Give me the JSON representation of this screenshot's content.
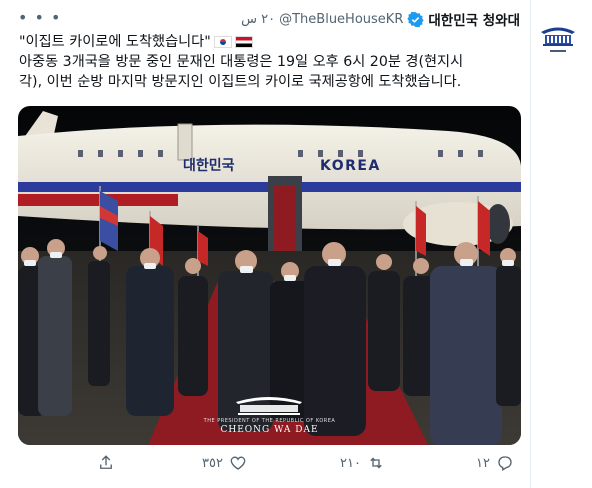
{
  "tweet": {
    "author_name": "대한민국 청와대",
    "handle": "@TheBlueHouseKR",
    "time": "٢٠ س",
    "title_line": "\"이집트 카이로에 도착했습니다\"",
    "body_line1": "아중동 3개국을 방문 중인 문재인 대통령은 19일 오후 6시 20분 경(현지시",
    "body_line2": "각), 이번 순방 마지막 방문지인 이집트의 카이로 국제공항에 도착했습니다."
  },
  "media": {
    "plane_text_korean": "대한민국",
    "plane_text_english": "KOREA",
    "caption_small": "THE PRESIDENT OF THE REPUBLIC OF KOREA",
    "caption_main": "CHEONG WA DAE"
  },
  "actions": {
    "reply_count": "١٢",
    "retweet_count": "٢١٠",
    "like_count": "٣٥٢"
  },
  "icons": {
    "reply": "reply-icon",
    "retweet": "retweet-icon",
    "like": "heart-icon",
    "share": "share-icon",
    "more": "more-icon",
    "verified": "verified-badge-icon"
  },
  "colors": {
    "verified_blue": "#1d9bf0",
    "secondary_text": "#536471",
    "carpet_red": "#8e1a22"
  }
}
